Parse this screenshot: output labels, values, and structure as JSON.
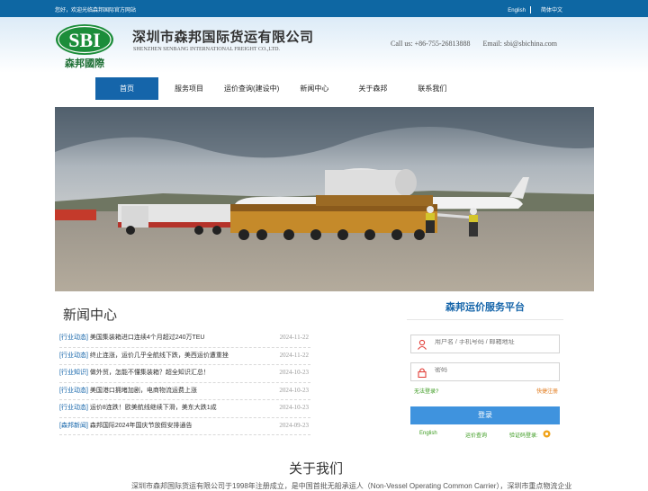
{
  "topbar": {
    "welcome": "您好，欢迎光临森邦国际官方网站",
    "lang_en": "English",
    "lang_cn": "简体中文"
  },
  "header": {
    "logo_letters": "SBI",
    "logo_caption": "森邦國際",
    "company_cn": "深圳市森邦国际货运有限公司",
    "company_en": "SHENZHEN SENBANG INTERNATIONAL FREIGHT CO.,LTD.",
    "phone": "Call us: +86-755-26813888",
    "email": "Email: sbi@sbichina.com"
  },
  "nav": {
    "items": [
      "首页",
      "服务项目",
      "运价查询(建设中)",
      "新闻中心",
      "关于森邦",
      "联系我们"
    ],
    "active_index": 0
  },
  "news": {
    "title": "新闻中心",
    "items": [
      {
        "category": "[行业动态]",
        "title": "美国集装箱进口连续4个月超过240万TEU",
        "date": "2024-11-22"
      },
      {
        "category": "[行业动态]",
        "title": "终止连涨，运价几乎全航线下跌，美西运价遭重挫",
        "date": "2024-11-22"
      },
      {
        "category": "[行业知识]",
        "title": "做外贸，怎能不懂集装箱？超全知识汇总！",
        "date": "2024-10-23"
      },
      {
        "category": "[行业动态]",
        "title": "美国港口拥堵加剧，电商物流运费上涨",
        "date": "2024-10-23"
      },
      {
        "category": "[行业动态]",
        "title": "运价8连跌！欧美航线继续下滑，美东大跌1成",
        "date": "2024-10-23"
      },
      {
        "category": "[森邦新闻]",
        "title": "森邦国际2024年国庆节放假安排通告",
        "date": "2024-09-23"
      }
    ]
  },
  "login": {
    "title": "森邦运价服务平台",
    "user_placeholder": "用户名 / 手机号码 / 邮箱地址",
    "password_placeholder": "密码",
    "forgot": "无法登录?",
    "register": "快捷注册",
    "button": "登录",
    "english": "English",
    "freight_query": "运价查询",
    "verify_login": "验证码登录:"
  },
  "about": {
    "title": "关于我们",
    "text": "深圳市森邦国际货运有限公司于1998年注册成立，是中国首批无船承运人（Non-Vessel Operating Common Carrier），深圳市重点物流企业"
  },
  "colors": {
    "primary_blue": "#1565aa",
    "topbar_blue": "#0e67a3",
    "button_blue": "#3f93de",
    "link_green": "#3a9a1e",
    "link_orange": "#e27b1d"
  }
}
